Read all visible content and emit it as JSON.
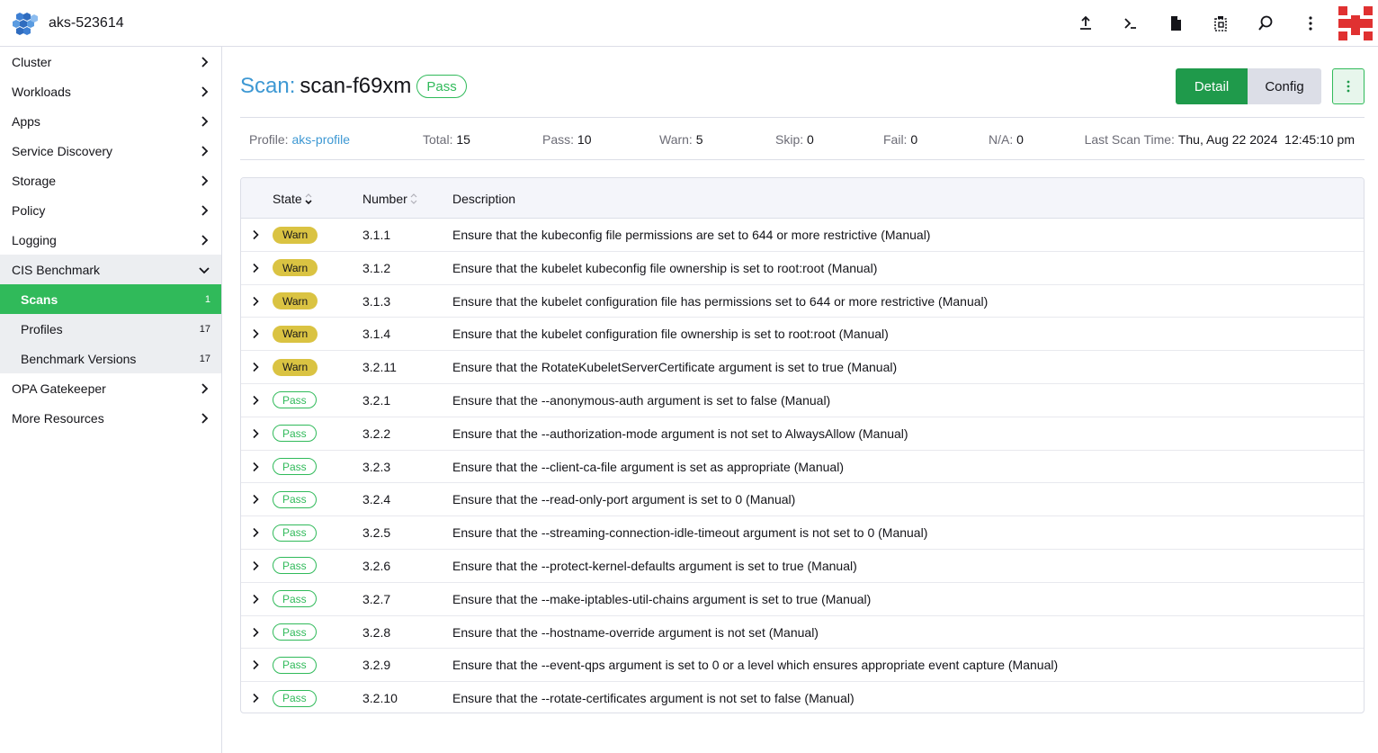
{
  "header": {
    "cluster_name": "aks-523614",
    "actions": [
      "upload-icon",
      "terminal-icon",
      "file-icon",
      "copy-config-icon",
      "search-icon",
      "more-vertical-icon"
    ]
  },
  "sidebar": {
    "items": [
      {
        "label": "Cluster"
      },
      {
        "label": "Workloads"
      },
      {
        "label": "Apps"
      },
      {
        "label": "Service Discovery"
      },
      {
        "label": "Storage"
      },
      {
        "label": "Policy"
      },
      {
        "label": "Logging"
      },
      {
        "label": "CIS Benchmark"
      },
      {
        "label": "OPA Gatekeeper"
      },
      {
        "label": "More Resources"
      }
    ],
    "cis_sub": [
      {
        "label": "Scans",
        "count": "1"
      },
      {
        "label": "Profiles",
        "count": "17"
      },
      {
        "label": "Benchmark Versions",
        "count": "17"
      }
    ]
  },
  "page": {
    "title_prefix": "Scan:",
    "title_name": "scan-f69xm",
    "state": "Pass",
    "detail_label": "Detail",
    "config_label": "Config",
    "kebab": "⋮"
  },
  "summary": {
    "profile_label": "Profile:",
    "profile_value": "aks-profile",
    "total_label": "Total:",
    "total_value": "15",
    "pass_label": "Pass:",
    "pass_value": "10",
    "warn_label": "Warn:",
    "warn_value": "5",
    "skip_label": "Skip:",
    "skip_value": "0",
    "fail_label": "Fail:",
    "fail_value": "0",
    "na_label": "N/A:",
    "na_value": "0",
    "last_scan_label": "Last Scan Time:",
    "last_scan_value": "Thu, Aug 22 2024  12:45:10 pm"
  },
  "table": {
    "headers": {
      "state": "State",
      "number": "Number",
      "description": "Description"
    },
    "rows": [
      {
        "state": "Warn",
        "number": "3.1.1",
        "description": "Ensure that the kubeconfig file permissions are set to 644 or more restrictive (Manual)"
      },
      {
        "state": "Warn",
        "number": "3.1.2",
        "description": "Ensure that the kubelet kubeconfig file ownership is set to root:root (Manual)"
      },
      {
        "state": "Warn",
        "number": "3.1.3",
        "description": "Ensure that the kubelet configuration file has permissions set to 644 or more restrictive (Manual)"
      },
      {
        "state": "Warn",
        "number": "3.1.4",
        "description": "Ensure that the kubelet configuration file ownership is set to root:root (Manual)"
      },
      {
        "state": "Warn",
        "number": "3.2.11",
        "description": "Ensure that the RotateKubeletServerCertificate argument is set to true (Manual)"
      },
      {
        "state": "Pass",
        "number": "3.2.1",
        "description": "Ensure that the --anonymous-auth argument is set to false (Manual)"
      },
      {
        "state": "Pass",
        "number": "3.2.2",
        "description": "Ensure that the --authorization-mode argument is not set to AlwaysAllow (Manual)"
      },
      {
        "state": "Pass",
        "number": "3.2.3",
        "description": "Ensure that the --client-ca-file argument is set as appropriate (Manual)"
      },
      {
        "state": "Pass",
        "number": "3.2.4",
        "description": "Ensure that the --read-only-port argument is set to 0 (Manual)"
      },
      {
        "state": "Pass",
        "number": "3.2.5",
        "description": "Ensure that the --streaming-connection-idle-timeout argument is not set to 0 (Manual)"
      },
      {
        "state": "Pass",
        "number": "3.2.6",
        "description": "Ensure that the --protect-kernel-defaults argument is set to true (Manual)"
      },
      {
        "state": "Pass",
        "number": "3.2.7",
        "description": "Ensure that the --make-iptables-util-chains argument is set to true (Manual)"
      },
      {
        "state": "Pass",
        "number": "3.2.8",
        "description": "Ensure that the --hostname-override argument is not set (Manual)"
      },
      {
        "state": "Pass",
        "number": "3.2.9",
        "description": "Ensure that the --event-qps argument is set to 0 or a level which ensures appropriate event capture (Manual)"
      },
      {
        "state": "Pass",
        "number": "3.2.10",
        "description": "Ensure that the --rotate-certificates argument is not set to false (Manual)"
      }
    ]
  },
  "colors": {
    "accent_green": "#30ba5a",
    "button_green": "#1f9a4b",
    "link_blue": "#3d98d3",
    "warn_yellow": "#dac342"
  }
}
